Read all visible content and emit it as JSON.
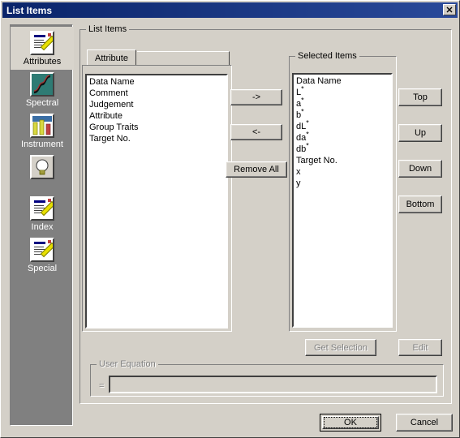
{
  "window": {
    "title": "List Items",
    "close_label": "✕",
    "close_icon": "close-icon"
  },
  "sidebar": {
    "items": [
      {
        "label": "Attributes",
        "icon": "note-pencil-icon",
        "selected": true
      },
      {
        "label": "Spectral",
        "icon": "spectral-curve-icon",
        "selected": false
      },
      {
        "label": "Instrument",
        "icon": "instrument-icon",
        "selected": false
      },
      {
        "label": "",
        "icon": "lightbulb-icon",
        "selected": false
      },
      {
        "label": "Index",
        "icon": "note-pencil-icon",
        "selected": false
      },
      {
        "label": "Special",
        "icon": "note-pencil-icon",
        "selected": false
      }
    ]
  },
  "main": {
    "group_title": "List Items",
    "tabs": [
      {
        "label": "Attribute",
        "selected": true
      }
    ],
    "available": {
      "items": [
        {
          "text": "Data Name",
          "sup": ""
        },
        {
          "text": "Comment",
          "sup": ""
        },
        {
          "text": "Judgement",
          "sup": ""
        },
        {
          "text": "Attribute",
          "sup": ""
        },
        {
          "text": "Group Traits",
          "sup": ""
        },
        {
          "text": "Target No.",
          "sup": ""
        }
      ]
    },
    "selected": {
      "title": "Selected Items",
      "items": [
        {
          "text": "Data Name",
          "sup": ""
        },
        {
          "text": "L",
          "sup": "*"
        },
        {
          "text": "a",
          "sup": "*"
        },
        {
          "text": "b",
          "sup": "*"
        },
        {
          "text": "dL",
          "sup": "*"
        },
        {
          "text": "da",
          "sup": "*"
        },
        {
          "text": "db",
          "sup": "*"
        },
        {
          "text": "Target No.",
          "sup": ""
        },
        {
          "text": "x",
          "sup": ""
        },
        {
          "text": "y",
          "sup": ""
        }
      ]
    },
    "transfer_buttons": {
      "add": "->",
      "remove": "<-",
      "remove_all": "Remove All"
    },
    "order_buttons": {
      "top": "Top",
      "up": "Up",
      "down": "Down",
      "bottom": "Bottom"
    },
    "action_buttons": {
      "get_selection": "Get Selection",
      "get_selection_enabled": false,
      "edit": "Edit",
      "edit_enabled": false
    },
    "user_equation": {
      "title": "User Equation",
      "equals_label": "=",
      "value": "",
      "placeholder": "",
      "enabled": false
    }
  },
  "footer": {
    "ok": "OK",
    "cancel": "Cancel"
  },
  "colors": {
    "face": "#d4d0c8",
    "title_left": "#0a246a",
    "title_right": "#2a4a9a",
    "sidebar": "#808080",
    "disabled_text": "#808080",
    "spectral_icon": "#2e7b74"
  }
}
